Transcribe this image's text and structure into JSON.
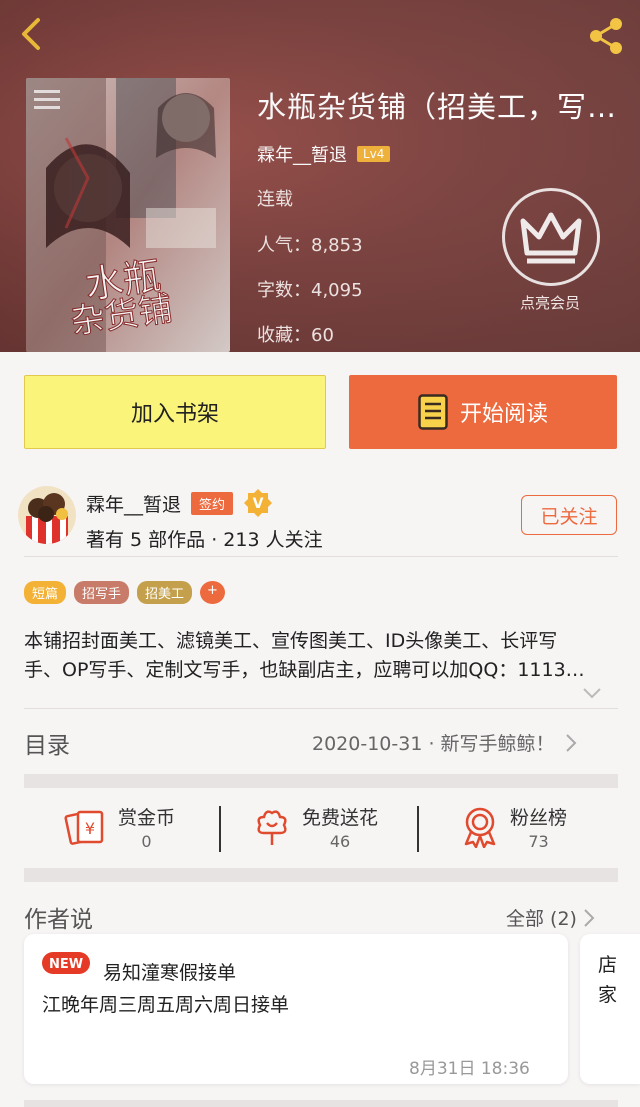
{
  "book": {
    "title": "水瓶杂货铺（招美工，写…",
    "author": "霖年__暂退",
    "level": "Lv4",
    "status": "连载",
    "popularity": "人气：8,853",
    "words": "字数：4,095",
    "favorites": "收藏：60",
    "member_label": "点亮会员"
  },
  "actions": {
    "add_shelf": "加入书架",
    "start_read": "开始阅读"
  },
  "author_card": {
    "name": "霖年__暂退",
    "sign_badge": "签约",
    "stats": "著有 5 部作品 · 213 人关注",
    "follow_label": "已关注"
  },
  "tags": [
    "短篇",
    "招写手",
    "招美工",
    "+"
  ],
  "description": [
    "本铺招封面美工、滤镜美工、宣传图美工、ID头像美工、长评写",
    "手、OP写手、定制文写手，也缺副店主，应聘可以加QQ：1113…"
  ],
  "toc": {
    "label": "目录",
    "latest": "2020-10-31 · 新写手鲸鲸！"
  },
  "stats": [
    {
      "label": "赏金币",
      "value": "0"
    },
    {
      "label": "免费送花",
      "value": "46"
    },
    {
      "label": "粉丝榜",
      "value": "73"
    }
  ],
  "author_says": {
    "label": "作者说",
    "all": "全部 (2)",
    "card": {
      "badge": "NEW",
      "title": "易知潼寒假接单",
      "body": "江晚年周三周五周六周日接单",
      "time": "8月31日  18:36"
    },
    "card2_text": "店家"
  },
  "colors": {
    "accent": "#ec6a3e",
    "shelf_button": "#fbf47a",
    "level_badge": "#f3b235"
  }
}
